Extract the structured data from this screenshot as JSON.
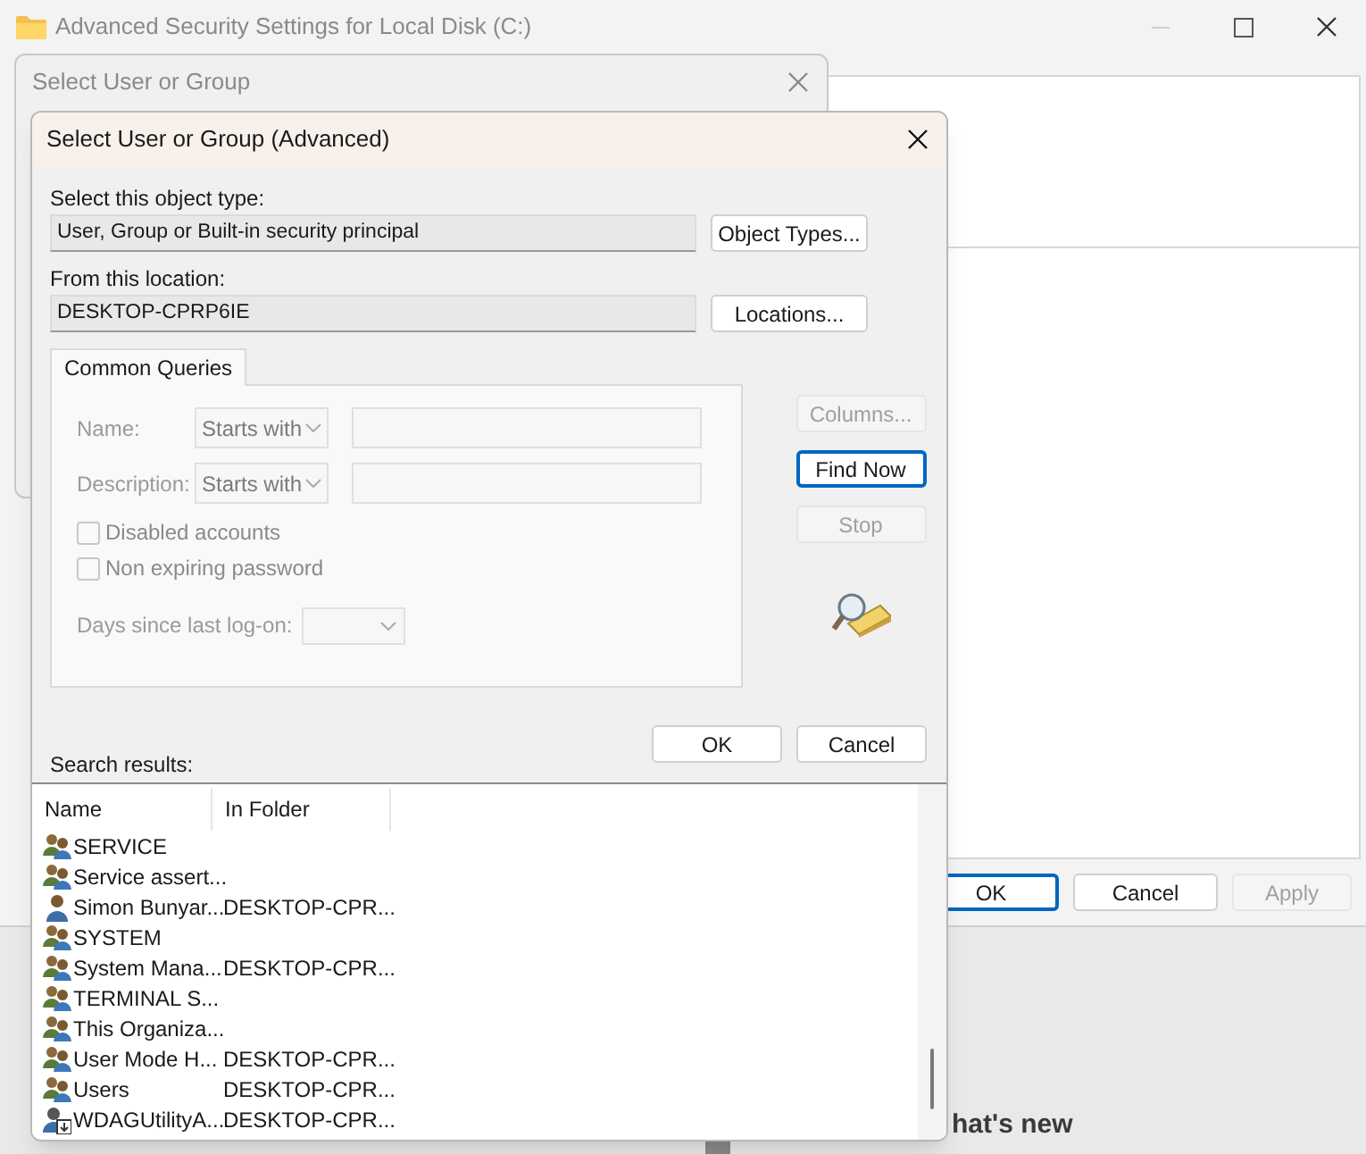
{
  "background_window": {
    "title": "Advanced Security Settings for Local Disk (C:)",
    "buttons": [
      {
        "label": "OK",
        "kind": "default",
        "disabled": false
      },
      {
        "label": "Cancel",
        "kind": "normal",
        "disabled": false
      },
      {
        "label": "Apply",
        "kind": "normal",
        "disabled": true
      }
    ]
  },
  "behind_text": "hat's new",
  "middle_dialog": {
    "title": "Select User or Group"
  },
  "dialog": {
    "title": "Select User or Group (Advanced)",
    "object_type": {
      "label": "Select this object type:",
      "value": "User, Group or Built-in security principal",
      "button": "Object Types..."
    },
    "location": {
      "label": "From this location:",
      "value": "DESKTOP-CPRP6IE",
      "button": "Locations..."
    },
    "tabs": [
      {
        "label": "Common Queries",
        "selected": true
      }
    ],
    "query_fields": [
      {
        "label": "Name:",
        "operator": "Starts with",
        "disabled": true
      },
      {
        "label": "Description:",
        "operator": "Starts with",
        "disabled": true
      }
    ],
    "checkboxes": [
      {
        "label": "Disabled accounts",
        "checked": false,
        "disabled": true
      },
      {
        "label": "Non expiring password",
        "checked": false,
        "disabled": true
      }
    ],
    "days_label": "Days since last log-on:",
    "side_buttons": [
      {
        "label": "Columns...",
        "disabled": true,
        "kind": "normal"
      },
      {
        "label": "Find Now",
        "disabled": false,
        "kind": "default"
      },
      {
        "label": "Stop",
        "disabled": true,
        "kind": "normal"
      }
    ],
    "buttons": [
      "OK",
      "Cancel"
    ],
    "results_label": "Search results:",
    "columns": [
      "Name",
      "In Folder"
    ],
    "rows": [
      {
        "name": "SERVICE",
        "kind": "group"
      },
      {
        "name": "Service assert...",
        "kind": "group"
      },
      {
        "name": "Simon Bunyar...",
        "folder": "DESKTOP-CPR...",
        "kind": "user"
      },
      {
        "name": "SYSTEM",
        "kind": "group"
      },
      {
        "name": "System Mana...",
        "folder": "DESKTOP-CPR...",
        "kind": "group"
      },
      {
        "name": "TERMINAL S...",
        "kind": "group"
      },
      {
        "name": "This Organiza...",
        "kind": "group"
      },
      {
        "name": "User Mode H...",
        "folder": "DESKTOP-CPR...",
        "kind": "group"
      },
      {
        "name": "Users",
        "folder": "DESKTOP-CPR...",
        "kind": "group"
      },
      {
        "name": "WDAGUtilityA...",
        "folder": "DESKTOP-CPR...",
        "kind": "user-download"
      }
    ]
  }
}
